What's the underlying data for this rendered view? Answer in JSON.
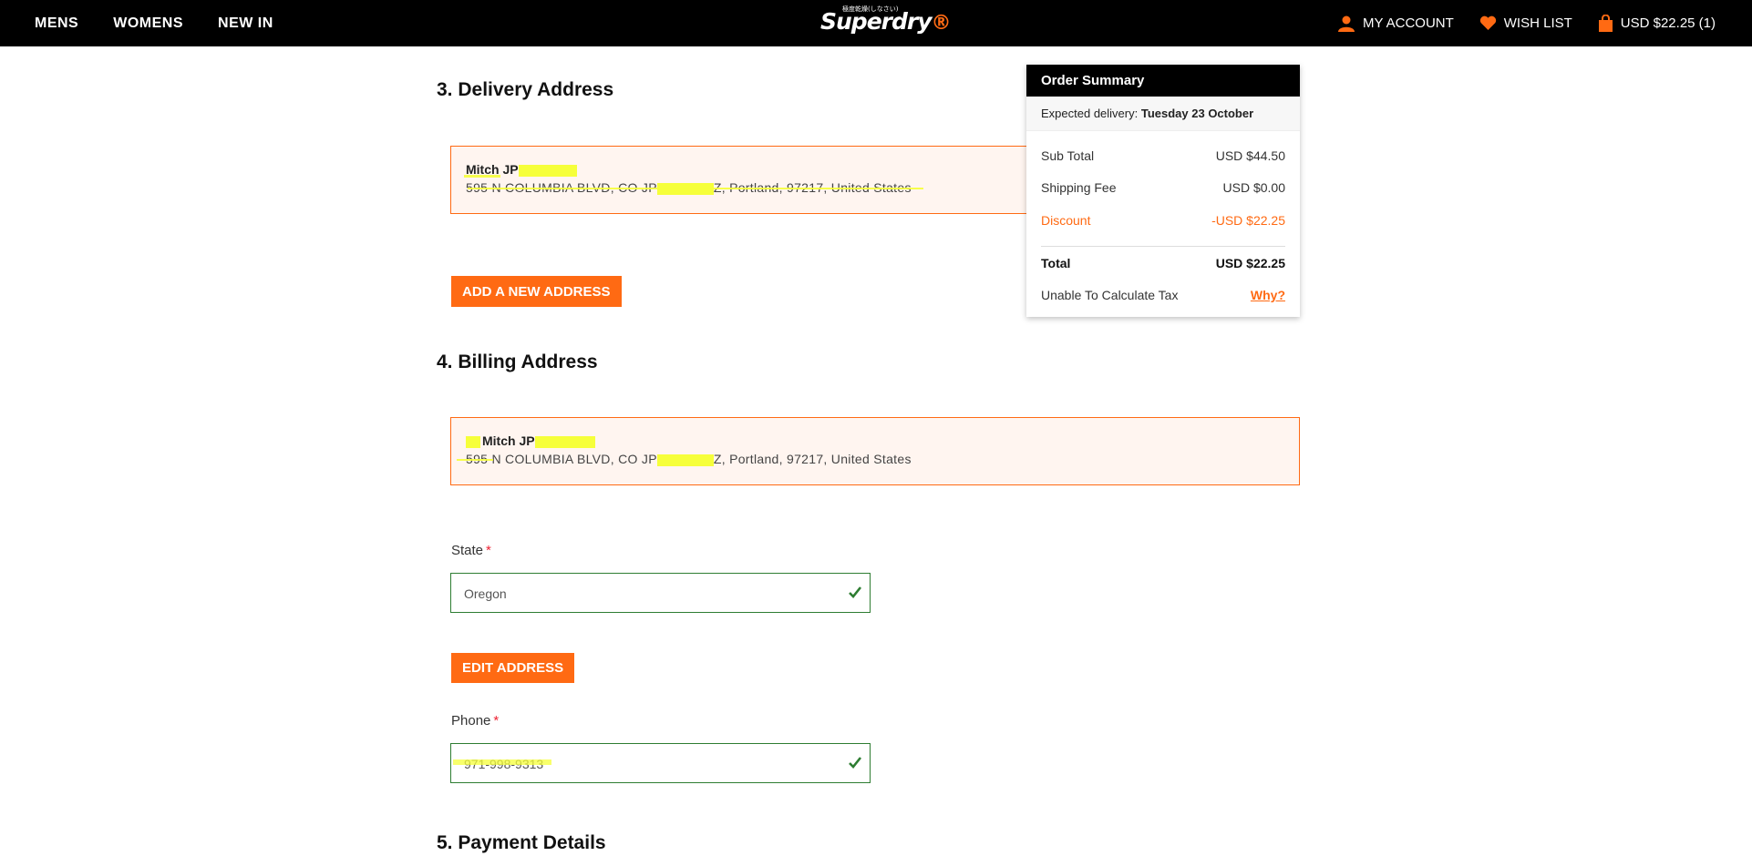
{
  "nav": {
    "left_links": [
      "MENS",
      "WOMENS",
      "NEW IN"
    ],
    "logo_text": "Superdry",
    "logo_mark": "®",
    "logo_tagline": "極度乾燥(しなさい)",
    "account_label": "MY ACCOUNT",
    "wishlist_label": "WISH LIST",
    "cart_label": "USD $22.25 (1)",
    "icons": {
      "account": "person-icon",
      "wishlist": "heart-icon",
      "cart": "shopping-bag-icon"
    }
  },
  "delivery": {
    "title": "3. Delivery Address",
    "address_name": "Mitch JP",
    "address_line": "595 N COLUMBIA BLVD, CO JP",
    "address_line_rest": "Z, Portland, 97217, United States",
    "add_button": "ADD A NEW ADDRESS"
  },
  "billing": {
    "title": "4. Billing Address",
    "address_name": "Mitch JP",
    "address_line": "595 N COLUMBIA BLVD, CO JP",
    "address_line_rest": "Z, Portland, 97217, United States",
    "state_label": "State",
    "state_value": "Oregon",
    "edit_button": "EDIT ADDRESS",
    "phone_label": "Phone",
    "phone_value": "971-998-9313",
    "required_mark": "*"
  },
  "payment": {
    "title": "5. Payment Details"
  },
  "summary": {
    "title": "Order Summary",
    "expected_label": "Expected delivery:",
    "expected_value": "Tuesday 23 October",
    "subtotal_label": "Sub Total",
    "subtotal_value": "USD $44.50",
    "shipping_label": "Shipping Fee",
    "shipping_value": "USD $0.00",
    "discount_label": "Discount",
    "discount_value": "-USD $22.25",
    "total_label": "Total",
    "total_value": "USD $22.25",
    "tax_label": "Unable To Calculate Tax",
    "tax_link": "Why?"
  },
  "colors": {
    "accent": "#ff6a13",
    "valid": "#2e7d32",
    "redaction": "#f6ff3a",
    "topbar": "#000000"
  }
}
